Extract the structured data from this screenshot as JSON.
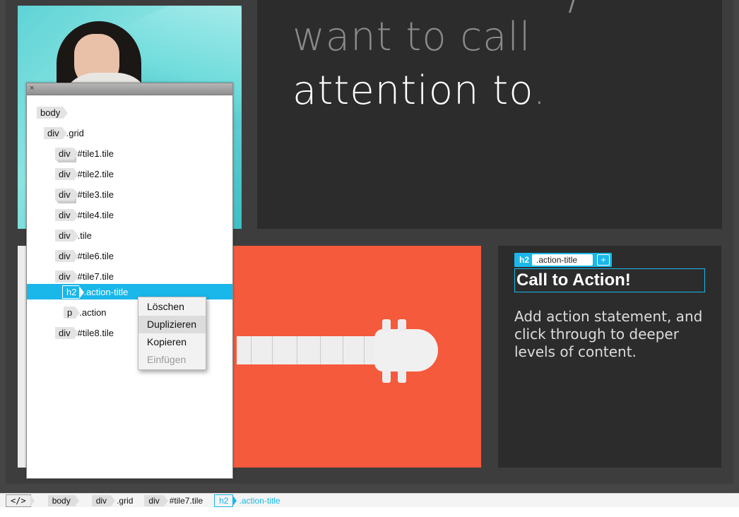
{
  "hero": {
    "line1": "want to call",
    "line2": "attention to",
    "line2_punct": "."
  },
  "tile7": {
    "chip_tag": "h2",
    "chip_class": ".action-title",
    "chip_add": "+",
    "title": "Call to Action!",
    "text": "Add action statement, and click through to deeper levels of content."
  },
  "dom_panel": {
    "close": "×",
    "nodes": [
      {
        "tag": "body",
        "name": ""
      },
      {
        "tag": "div",
        "name": ".grid"
      },
      {
        "tag": "div",
        "name": "#tile1.tile"
      },
      {
        "tag": "div",
        "name": "#tile2.tile"
      },
      {
        "tag": "div",
        "name": "#tile3.tile"
      },
      {
        "tag": "div",
        "name": "#tile4.tile"
      },
      {
        "tag": "div",
        "name": ".tile"
      },
      {
        "tag": "div",
        "name": "#tile6.tile"
      },
      {
        "tag": "div",
        "name": "#tile7.tile"
      },
      {
        "tag": "h2",
        "name": ".action-title"
      },
      {
        "tag": "p",
        "name": ".action"
      },
      {
        "tag": "div",
        "name": "#tile8.tile"
      }
    ]
  },
  "context_menu": {
    "items": [
      "Löschen",
      "Duplizieren",
      "Kopieren",
      "Einfügen"
    ]
  },
  "breadcrumb": {
    "code": "</>",
    "items": [
      {
        "tag": "body",
        "name": ""
      },
      {
        "tag": "div",
        "name": ".grid"
      },
      {
        "tag": "div",
        "name": "#tile7.tile"
      },
      {
        "tag": "h2",
        "name": ".action-title"
      }
    ]
  },
  "colors": {
    "accent": "#1ab7ea",
    "orange_tile": "#f55a3c",
    "dark_tile": "#2c2c2c"
  }
}
